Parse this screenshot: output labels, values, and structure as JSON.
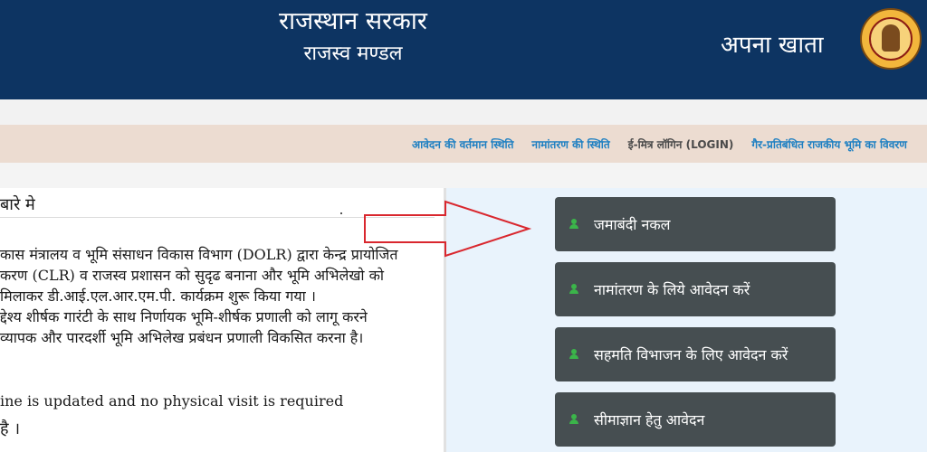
{
  "header": {
    "title": "राजस्थान सरकार",
    "subtitle": "राजस्व मण्डल",
    "right_title": "अपना खाता",
    "seal_icon": "government-seal-icon",
    "background_color": "#0d3462"
  },
  "nav": {
    "items": [
      {
        "label": "आवेदन की वर्तमान स्थिति"
      },
      {
        "label": "नामांतरण की स्थिति"
      },
      {
        "label": "ई-मित्र लॉगिन (LOGIN)"
      },
      {
        "label": "गैर-प्रतिबंधित राजकीय भूमि का विवरण"
      }
    ],
    "link_color": "#1d7fc2"
  },
  "about": {
    "heading": "बारे मे",
    "lines": [
      "कास मंत्रालय व भूमि संसाधन विकास विभाग (DOLR) द्वारा केन्द्र प्रायोजित",
      "करण (CLR) व राजस्व प्रशासन को सुदृढ बनाना और भूमि अभिलेखो को",
      "मिलाकर डी.आई.एल.आर.एम.पी. कार्यक्रम शुरू किया गया ।",
      "द्देश्य शीर्षक गारंटी के साथ निर्णायक भूमि-शीर्षक प्रणाली को लागू करने",
      "व्यापक और पारदर्शी भूमि अभिलेख प्रबंधन प्रणाली विकसित करना है।"
    ],
    "english_line": "ine is updated and no physical visit is required",
    "closing_line": "है ।"
  },
  "services": {
    "items": [
      {
        "label": "जमाबंदी नकल",
        "icon": "user-icon"
      },
      {
        "label": "नामांतरण के लिये आवेदन करें",
        "icon": "user-icon"
      },
      {
        "label": "सहमति विभाजन के लिए आवेदन करें",
        "icon": "user-icon"
      },
      {
        "label": "सीमाज्ञान हेतु आवेदन",
        "icon": "user-icon"
      }
    ],
    "card_color": "#464e51",
    "icon_color": "#3bb54a",
    "arrow_color": "#d9272e"
  }
}
